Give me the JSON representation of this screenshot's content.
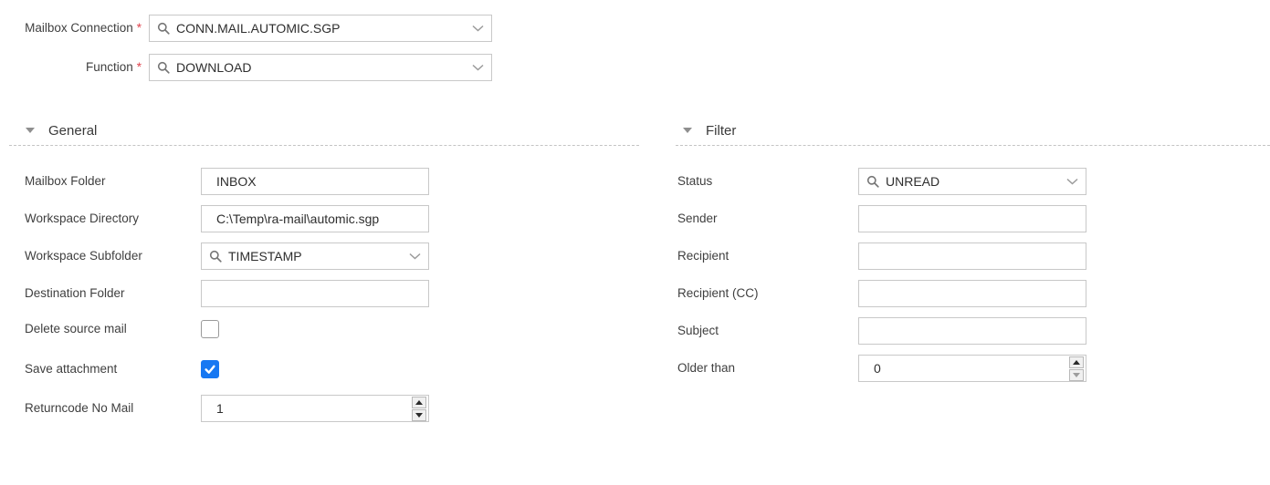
{
  "colors": {
    "accent": "#1778f2",
    "required": "#e0444e",
    "input_border": "#c8c8c8",
    "icon_gray": "#757575"
  },
  "icons": {
    "combo_left": "search-icon",
    "combo_right": "chevron-down-icon",
    "section_toggle": "triangle-down-icon"
  },
  "top_form": {
    "required_marker": "*",
    "mailbox_connection": {
      "label": "Mailbox Connection",
      "value": "CONN.MAIL.AUTOMIC.SGP"
    },
    "function": {
      "label": "Function",
      "value": "DOWNLOAD"
    }
  },
  "sections": {
    "general": {
      "title": "General",
      "fields": {
        "mailbox_folder": {
          "label": "Mailbox Folder",
          "value": "INBOX"
        },
        "workspace_directory": {
          "label": "Workspace Directory",
          "value": "C:\\Temp\\ra-mail\\automic.sgp"
        },
        "workspace_subfolder": {
          "label": "Workspace Subfolder",
          "value": "TIMESTAMP"
        },
        "destination_folder": {
          "label": "Destination Folder",
          "value": ""
        },
        "delete_source_mail": {
          "label": "Delete source mail",
          "checked": false
        },
        "save_attachment": {
          "label": "Save attachment",
          "checked": true
        },
        "returncode_no_mail": {
          "label": "Returncode No Mail",
          "value": "1"
        }
      }
    },
    "filter": {
      "title": "Filter",
      "fields": {
        "status": {
          "label": "Status",
          "value": "UNREAD"
        },
        "sender": {
          "label": "Sender",
          "value": ""
        },
        "recipient": {
          "label": "Recipient",
          "value": ""
        },
        "recipient_cc": {
          "label": "Recipient (CC)",
          "value": ""
        },
        "subject": {
          "label": "Subject",
          "value": ""
        },
        "older_than": {
          "label": "Older than",
          "value": "0"
        }
      }
    }
  }
}
